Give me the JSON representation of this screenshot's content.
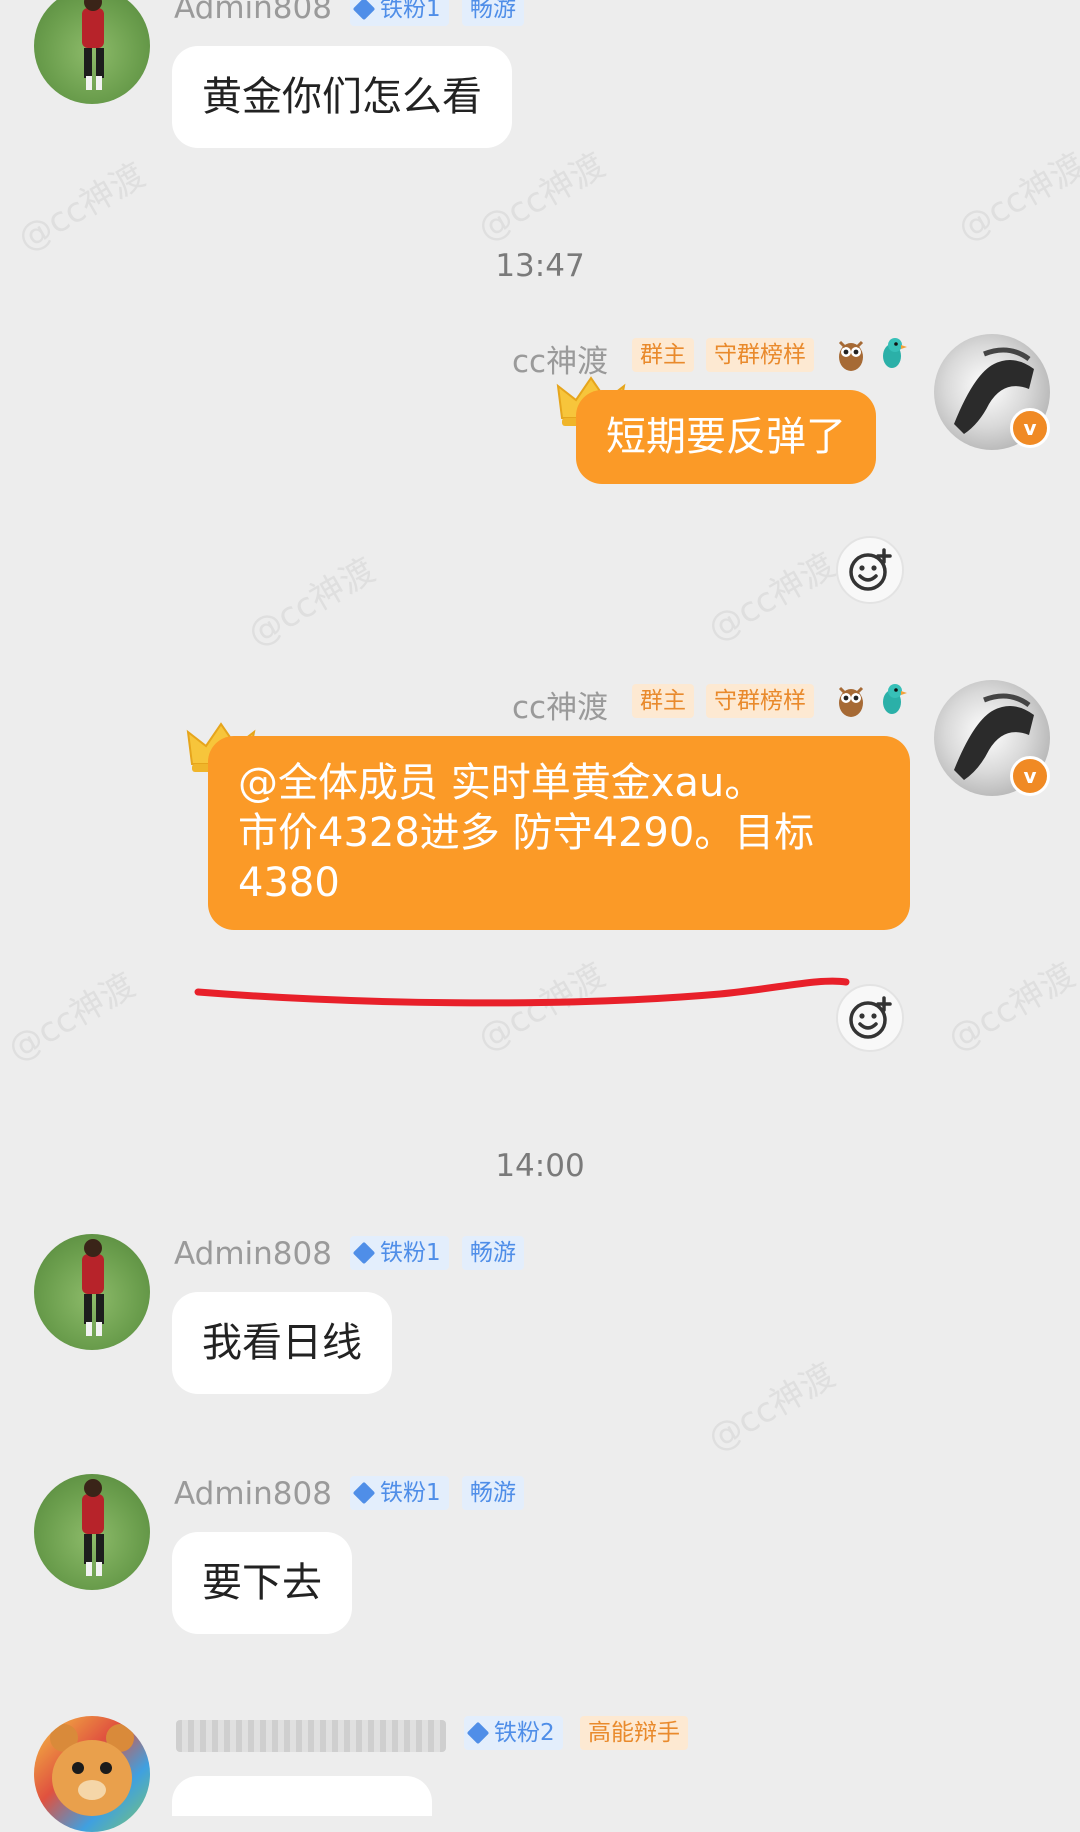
{
  "messages": {
    "m1": {
      "sender": "Admin808",
      "tag_fan": "铁粉1",
      "tag_level": "畅游",
      "text": "黄金你们怎么看"
    },
    "time1": "13:47",
    "m2": {
      "sender": "cc神渡",
      "tag_owner": "群主",
      "tag_title": "守群榜样",
      "text": "短期要反弹了"
    },
    "m3": {
      "sender": "cc神渡",
      "tag_owner": "群主",
      "tag_title": "守群榜样",
      "line1": "@全体成员 实时单黄金xau。",
      "line2": "市价4328进多 防守4290。目标",
      "line3": "4380"
    },
    "time2": "14:00",
    "m4": {
      "sender": "Admin808",
      "tag_fan": "铁粉1",
      "tag_level": "畅游",
      "text": "我看日线"
    },
    "m5": {
      "sender": "Admin808",
      "tag_fan": "铁粉1",
      "tag_level": "畅游",
      "text": "要下去"
    },
    "m6": {
      "tag_fan": "铁粉2",
      "tag_level": "高能辩手"
    }
  },
  "watermark_text": "@cc神渡",
  "verified_badge": "v",
  "colors": {
    "accent_orange": "#fb9a27",
    "background": "#ededed",
    "annotation_red": "#e8202a"
  },
  "icons": [
    "crown-icon",
    "owl-icon",
    "bird-icon",
    "add-reaction-icon",
    "verified-icon"
  ]
}
